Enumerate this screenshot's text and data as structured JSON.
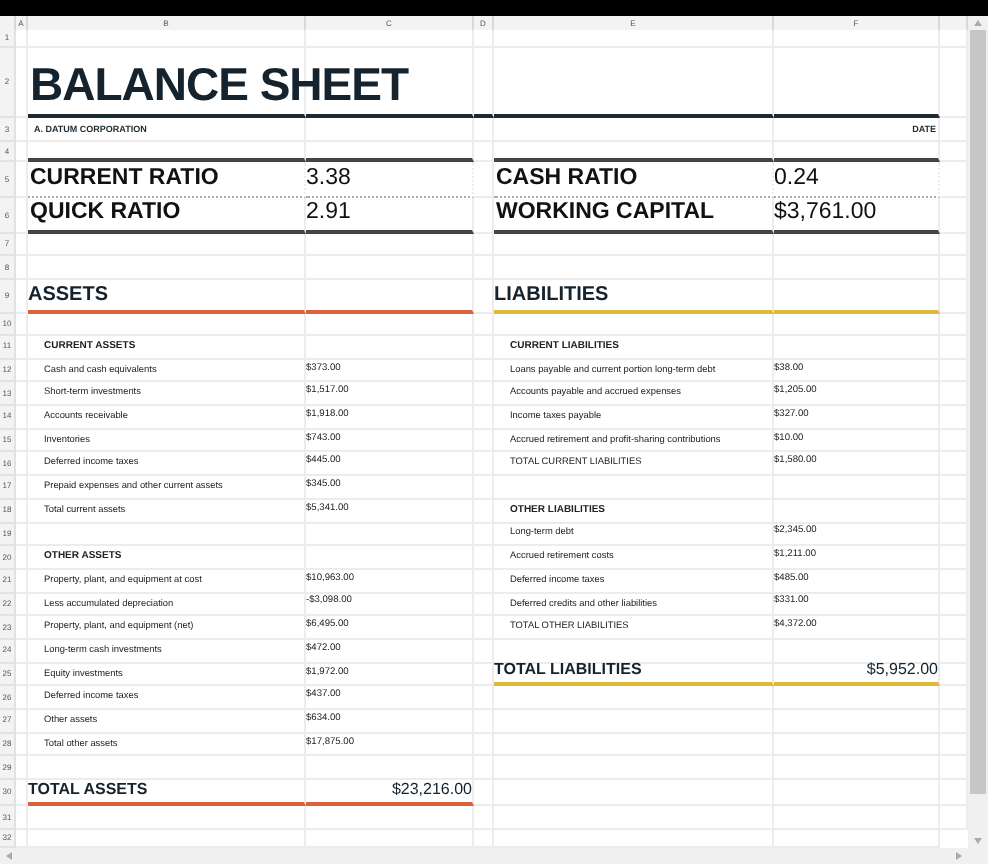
{
  "column_headers": [
    "A",
    "B",
    "C",
    "D",
    "E",
    "F"
  ],
  "row_numbers": [
    "1",
    "2",
    "3",
    "4",
    "5",
    "6",
    "7",
    "8",
    "9",
    "10",
    "11",
    "12",
    "13",
    "14",
    "15",
    "16",
    "17",
    "18",
    "19",
    "20",
    "21",
    "22",
    "23",
    "24",
    "25",
    "26",
    "27",
    "28",
    "29",
    "30",
    "31",
    "32"
  ],
  "title": "BALANCE SHEET",
  "company": "A. DATUM CORPORATION",
  "date_label": "DATE",
  "ratios": [
    {
      "label": "CURRENT RATIO",
      "value": "3.38"
    },
    {
      "label": "CASH RATIO",
      "value": "0.24"
    },
    {
      "label": "QUICK RATIO",
      "value": "2.91"
    },
    {
      "label": "WORKING CAPITAL",
      "value": "$3,761.00"
    }
  ],
  "assets": {
    "heading": "ASSETS",
    "sections": [
      {
        "heading": "CURRENT ASSETS",
        "items": [
          {
            "label": "Cash and cash equivalents",
            "value": "$373.00"
          },
          {
            "label": "Short-term investments",
            "value": "$1,517.00"
          },
          {
            "label": "Accounts receivable",
            "value": "$1,918.00"
          },
          {
            "label": "Inventories",
            "value": "$743.00"
          },
          {
            "label": "Deferred income taxes",
            "value": "$445.00"
          },
          {
            "label": "Prepaid expenses and other current assets",
            "value": "$345.00"
          },
          {
            "label": "Total current assets",
            "value": "$5,341.00"
          }
        ]
      },
      {
        "heading": "OTHER ASSETS",
        "items": [
          {
            "label": "Property, plant, and equipment at cost",
            "value": "$10,963.00"
          },
          {
            "label": "Less accumulated depreciation",
            "value": "-$3,098.00"
          },
          {
            "label": "Property, plant, and equipment (net)",
            "value": "$6,495.00"
          },
          {
            "label": "Long-term cash investments",
            "value": "$472.00"
          },
          {
            "label": "Equity investments",
            "value": "$1,972.00"
          },
          {
            "label": "Deferred income taxes",
            "value": "$437.00"
          },
          {
            "label": "Other assets",
            "value": "$634.00"
          },
          {
            "label": "Total other assets",
            "value": "$17,875.00"
          }
        ]
      }
    ],
    "total": {
      "label": "TOTAL ASSETS",
      "value": "$23,216.00"
    }
  },
  "liabilities": {
    "heading": "LIABILITIES",
    "sections": [
      {
        "heading": "CURRENT LIABILITIES",
        "items": [
          {
            "label": "Loans payable and current portion long-term debt",
            "value": "$38.00"
          },
          {
            "label": "Accounts payable and accrued expenses",
            "value": "$1,205.00"
          },
          {
            "label": "Income taxes payable",
            "value": "$327.00"
          },
          {
            "label": "Accrued retirement and profit-sharing contributions",
            "value": "$10.00"
          },
          {
            "label": "TOTAL CURRENT LIABILITIES",
            "value": "$1,580.00"
          }
        ]
      },
      {
        "heading": "OTHER LIABILITIES",
        "items": [
          {
            "label": "Long-term debt",
            "value": "$2,345.00"
          },
          {
            "label": "Accrued retirement costs",
            "value": "$1,211.00"
          },
          {
            "label": "Deferred income taxes",
            "value": "$485.00"
          },
          {
            "label": "Deferred credits and other liabilities",
            "value": "$331.00"
          },
          {
            "label": "TOTAL OTHER LIABILITIES",
            "value": "$4,372.00"
          }
        ]
      }
    ],
    "total": {
      "label": "TOTAL LIABILITIES",
      "value": "$5,952.00"
    }
  }
}
